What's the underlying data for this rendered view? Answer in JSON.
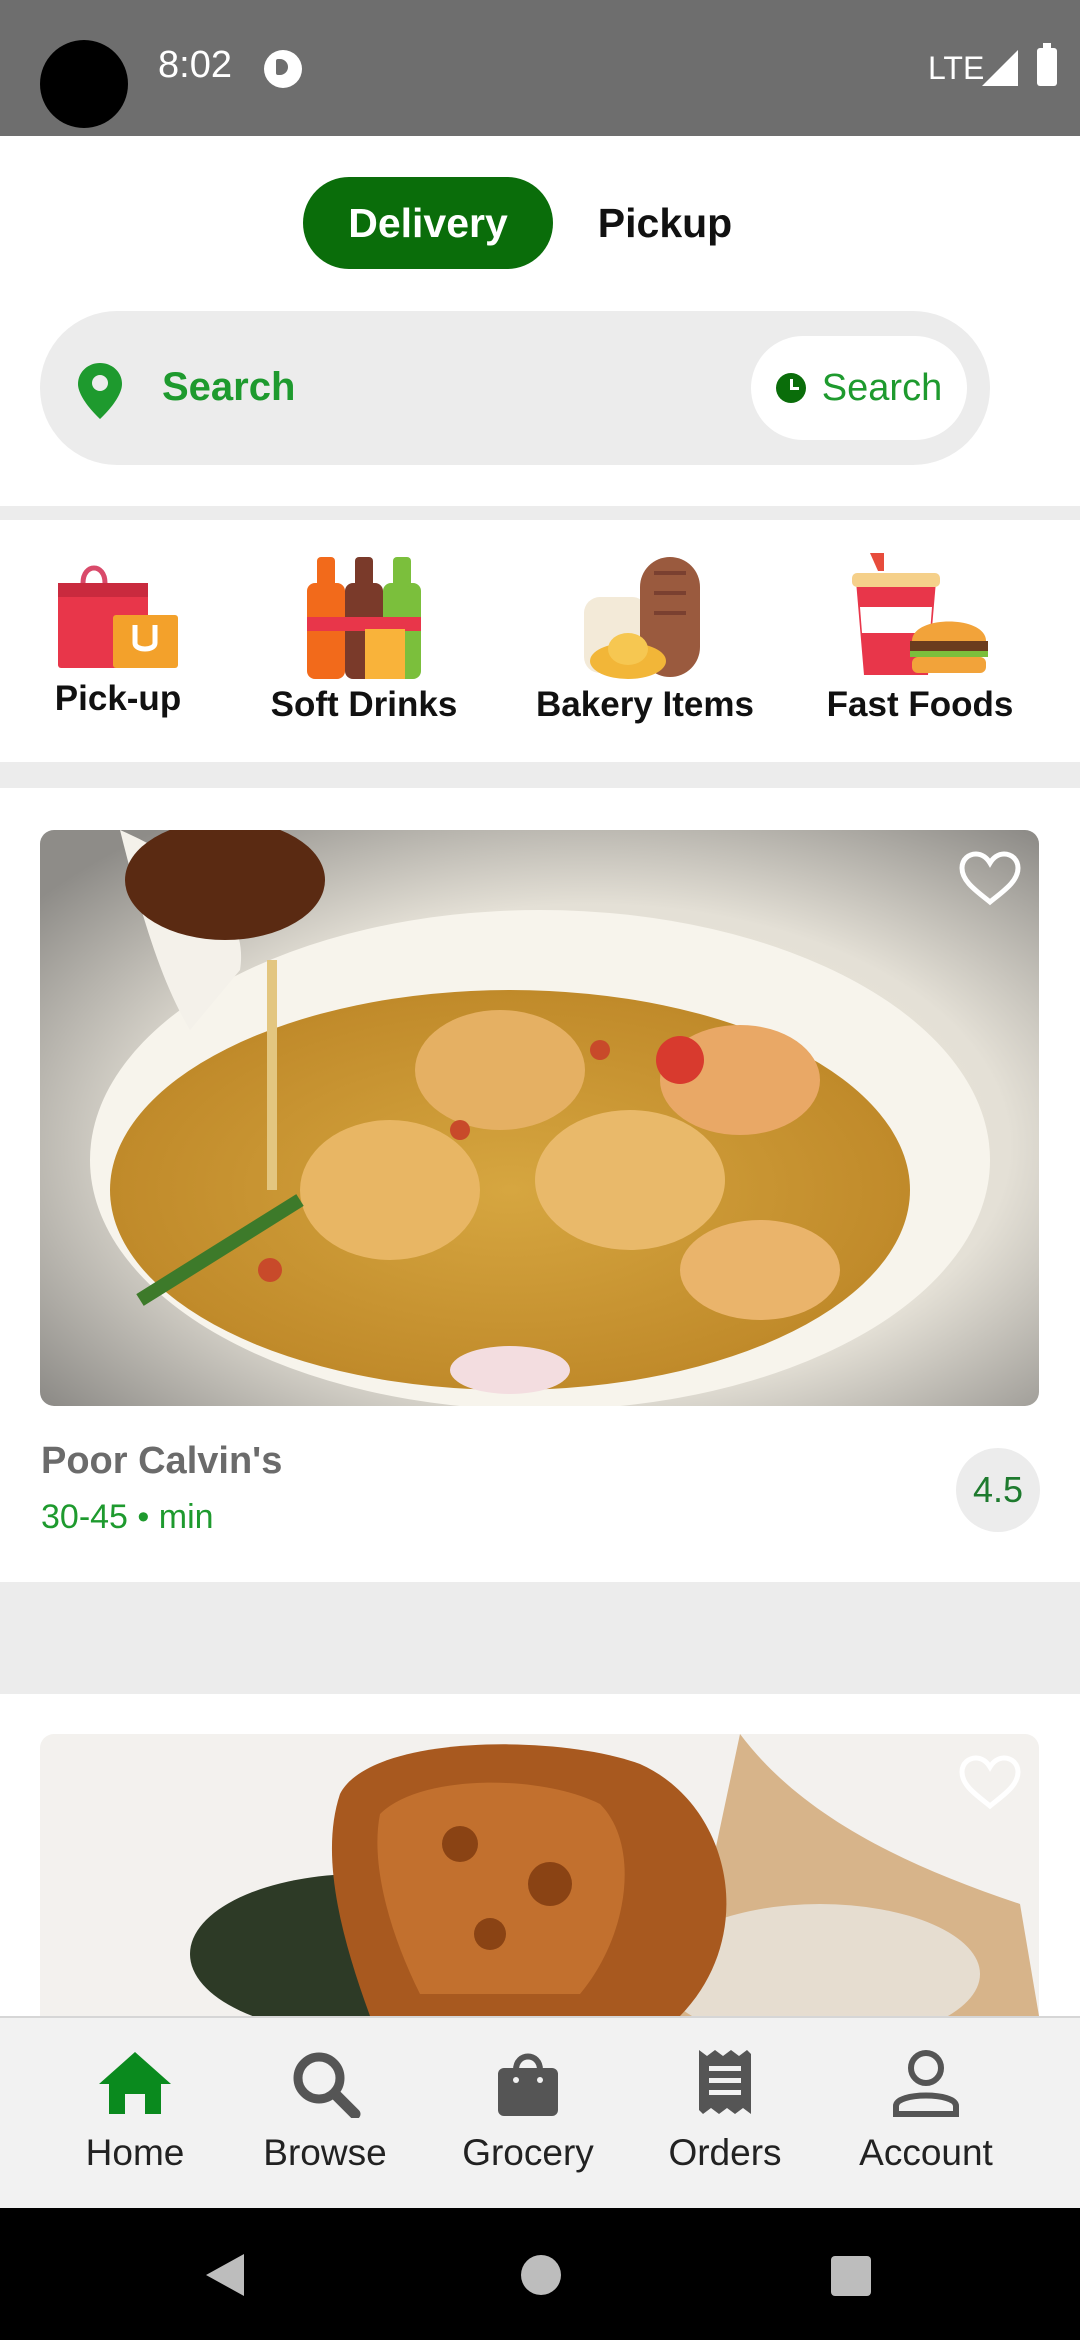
{
  "status_bar": {
    "time": "8:02",
    "network": "LTE"
  },
  "mode_toggle": {
    "delivery_label": "Delivery",
    "pickup_label": "Pickup",
    "selected": "Delivery"
  },
  "search": {
    "location_label": "Search",
    "schedule_label": "Search"
  },
  "categories": [
    {
      "label": "Pick-up",
      "icon": "shopping-bags-icon"
    },
    {
      "label": "Soft Drinks",
      "icon": "soda-bottles-icon"
    },
    {
      "label": "Bakery Items",
      "icon": "bread-icon"
    },
    {
      "label": "Fast Foods",
      "icon": "burger-drink-icon"
    }
  ],
  "restaurants": [
    {
      "name": "Poor Calvin's",
      "eta": "30-45 • min",
      "rating": "4.5",
      "photo": "seared scallops and shrimp in broth"
    },
    {
      "photo": "fried chicken on greens"
    }
  ],
  "bottom_nav": {
    "items": [
      {
        "label": "Home",
        "icon": "home-icon",
        "active": true
      },
      {
        "label": "Browse",
        "icon": "search-icon",
        "active": false
      },
      {
        "label": "Grocery",
        "icon": "shopping-bag-icon",
        "active": false
      },
      {
        "label": "Orders",
        "icon": "receipt-icon",
        "active": false
      },
      {
        "label": "Account",
        "icon": "person-icon",
        "active": false
      }
    ]
  },
  "colors": {
    "brand_green": "#0a6d0a",
    "accent_green": "#1e9a2e",
    "band_gray": "#ececec"
  }
}
